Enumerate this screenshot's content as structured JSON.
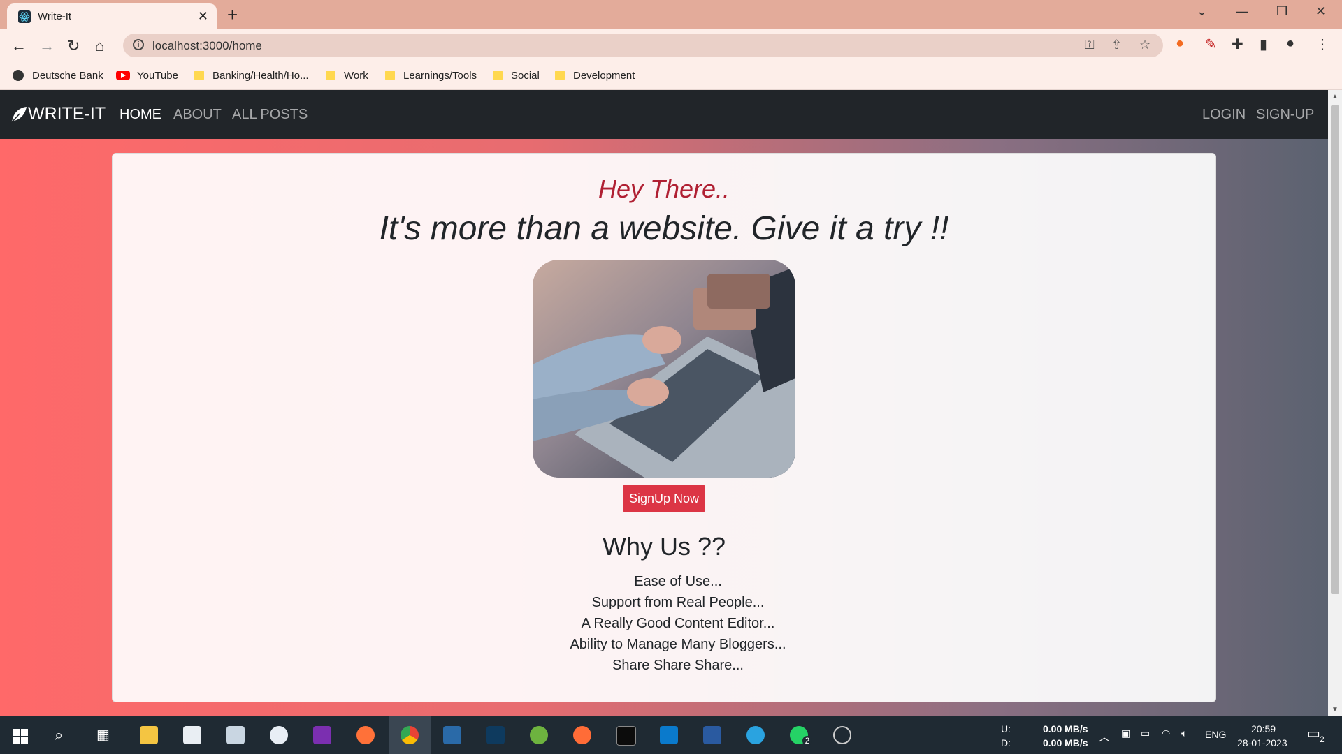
{
  "browser": {
    "tab_title": "Write-It",
    "tab_close": "✕",
    "new_tab": "+",
    "url": "localhost:3000/home",
    "bookmarks": [
      "Deutsche Bank",
      "YouTube",
      "Banking/Health/Ho...",
      "Work",
      "Learnings/Tools",
      "Social",
      "Development"
    ]
  },
  "app": {
    "brand": "WRITE-IT",
    "nav": {
      "home": "HOME",
      "about": "ABOUT",
      "all_posts": "ALL POSTS",
      "login": "LOGIN",
      "signup": "SIGN-UP"
    },
    "hey": "Hey There..",
    "tagline": "It's more than a website. Give it a try !!",
    "signup_button": "SignUp Now",
    "why_title": "Why Us ??",
    "reasons": [
      "Ease of Use...",
      "Support from Real People...",
      "A Really Good Content Editor...",
      "Ability to Manage Many Bloggers...",
      "Share Share Share..."
    ]
  },
  "taskbar": {
    "upload_label": "U:",
    "download_label": "D:",
    "upload_speed": "0.00 MB/s",
    "download_speed": "0.00 MB/s",
    "language": "ENG",
    "time": "20:59",
    "date": "28-01-2023",
    "notification_count": "2",
    "whatsapp_badge": "2"
  },
  "colors": {
    "accent": "#dc3545",
    "navbar": "#212529",
    "hey": "#b02033"
  }
}
